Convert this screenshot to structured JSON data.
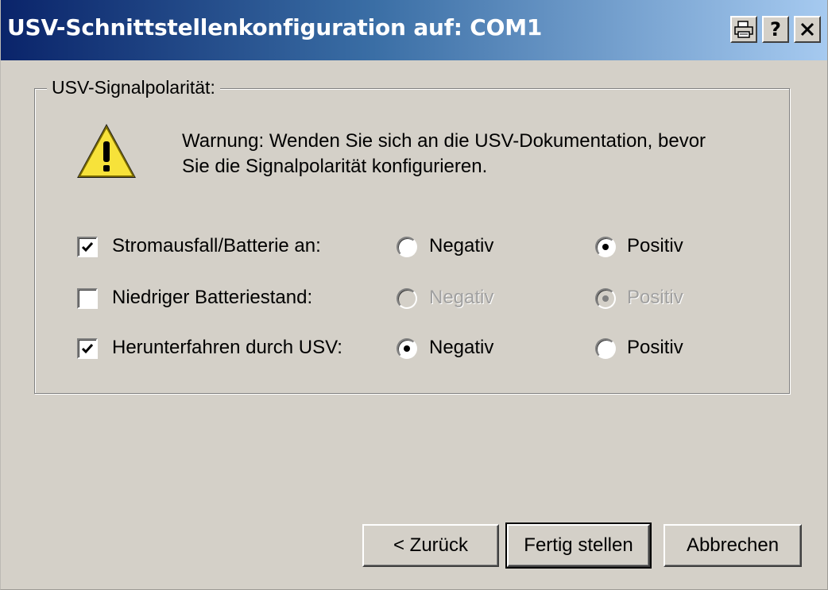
{
  "window": {
    "title": "USV-Schnittstellenkonfiguration auf: COM1",
    "title_buttons": [
      {
        "name": "print",
        "label": "🖶"
      },
      {
        "name": "help",
        "label": "?"
      },
      {
        "name": "close",
        "label": "✕"
      }
    ]
  },
  "group": {
    "label": "USV-Signalpolarität:",
    "warning_line1": "Warnung: Wenden Sie sich an die USV-Dokumentation, bevor",
    "warning_line2": "Sie die Signalpolarität konfigurieren.",
    "warning_icon": "warning-icon"
  },
  "signals": [
    {
      "label": "Stromausfall/Batterie an:",
      "checked": true,
      "enabled": true,
      "negative_label": "Negativ",
      "positive_label": "Positiv",
      "selected": "positive"
    },
    {
      "label": "Niedriger Batteriestand:",
      "checked": false,
      "enabled": false,
      "negative_label": "Negativ",
      "positive_label": "Positiv",
      "selected": "positive"
    },
    {
      "label": "Herunterfahren durch USV:",
      "checked": true,
      "enabled": true,
      "negative_label": "Negativ",
      "positive_label": "Positiv",
      "selected": "negative"
    }
  ],
  "buttons": {
    "back": "< Zurück",
    "finish": "Fertig stellen",
    "cancel": "Abbrechen"
  },
  "colors": {
    "titlebar_start": "#0a246a",
    "titlebar_end": "#a6caf0",
    "face": "#d4d0c8"
  }
}
